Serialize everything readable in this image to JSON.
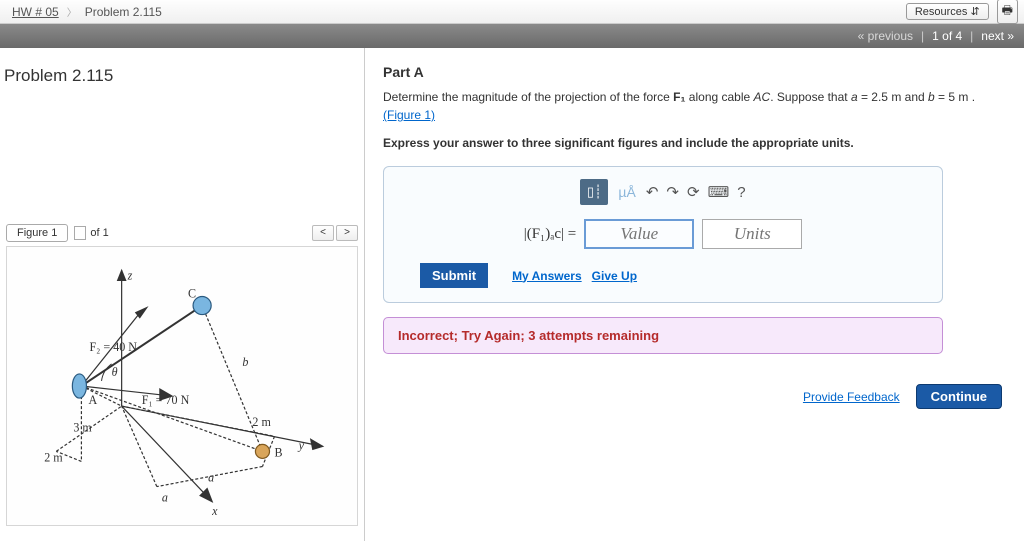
{
  "nav": {
    "hw_label": "HW # 05",
    "problem_label": "Problem 2.115",
    "resources_label": "Resources",
    "updown": "⇵"
  },
  "pager": {
    "previous": "« previous",
    "status": "1 of 4",
    "next": "next »"
  },
  "problem": {
    "title": "Problem 2.115"
  },
  "figure": {
    "tab_label": "Figure 1",
    "of_label": "of 1",
    "prev_btn": "<",
    "next_btn": ">",
    "labels": {
      "z": "z",
      "C": "C",
      "b": "b",
      "F2": "F₂ = 40 N",
      "theta": "θ",
      "F1": "F₁ = 70 N",
      "A": "A",
      "3m": "3 m",
      "2m_left": "2 m",
      "2m_right": "2 m",
      "a1": "a",
      "a2": "a",
      "B": "B",
      "y": "y",
      "x": "x"
    }
  },
  "part": {
    "label": "Part A",
    "text_1": "Determine the magnitude of the projection of the force ",
    "F1_sym": "F₁",
    "text_2": " along cable ",
    "AC_sym": "AC",
    "text_3": ". Suppose that ",
    "a_sym": "a",
    "a_val": " = 2.5  m",
    "text_4": " and ",
    "b_sym": "b",
    "b_val": " = 5  m",
    "text_5": " . ",
    "figure_link": "(Figure 1)",
    "instruction": "Express your answer to three significant figures and include the appropriate units."
  },
  "toolbar": {
    "tpl_icon": "▯┊",
    "units_hint": "µÅ",
    "undo_icon": "↶",
    "redo_icon": "↷",
    "reset_icon": "⟳",
    "kbd_icon": "⌨",
    "help_icon": "?"
  },
  "answer": {
    "lhs": "|(F₁)ₐc| =",
    "value_ph": "Value",
    "units_ph": "Units",
    "submit": "Submit",
    "my_answers": "My Answers",
    "give_up": "Give Up"
  },
  "feedback": {
    "msg": "Incorrect; Try Again; 3 attempts remaining"
  },
  "footer": {
    "provide_feedback": "Provide Feedback",
    "continue": "Continue"
  }
}
